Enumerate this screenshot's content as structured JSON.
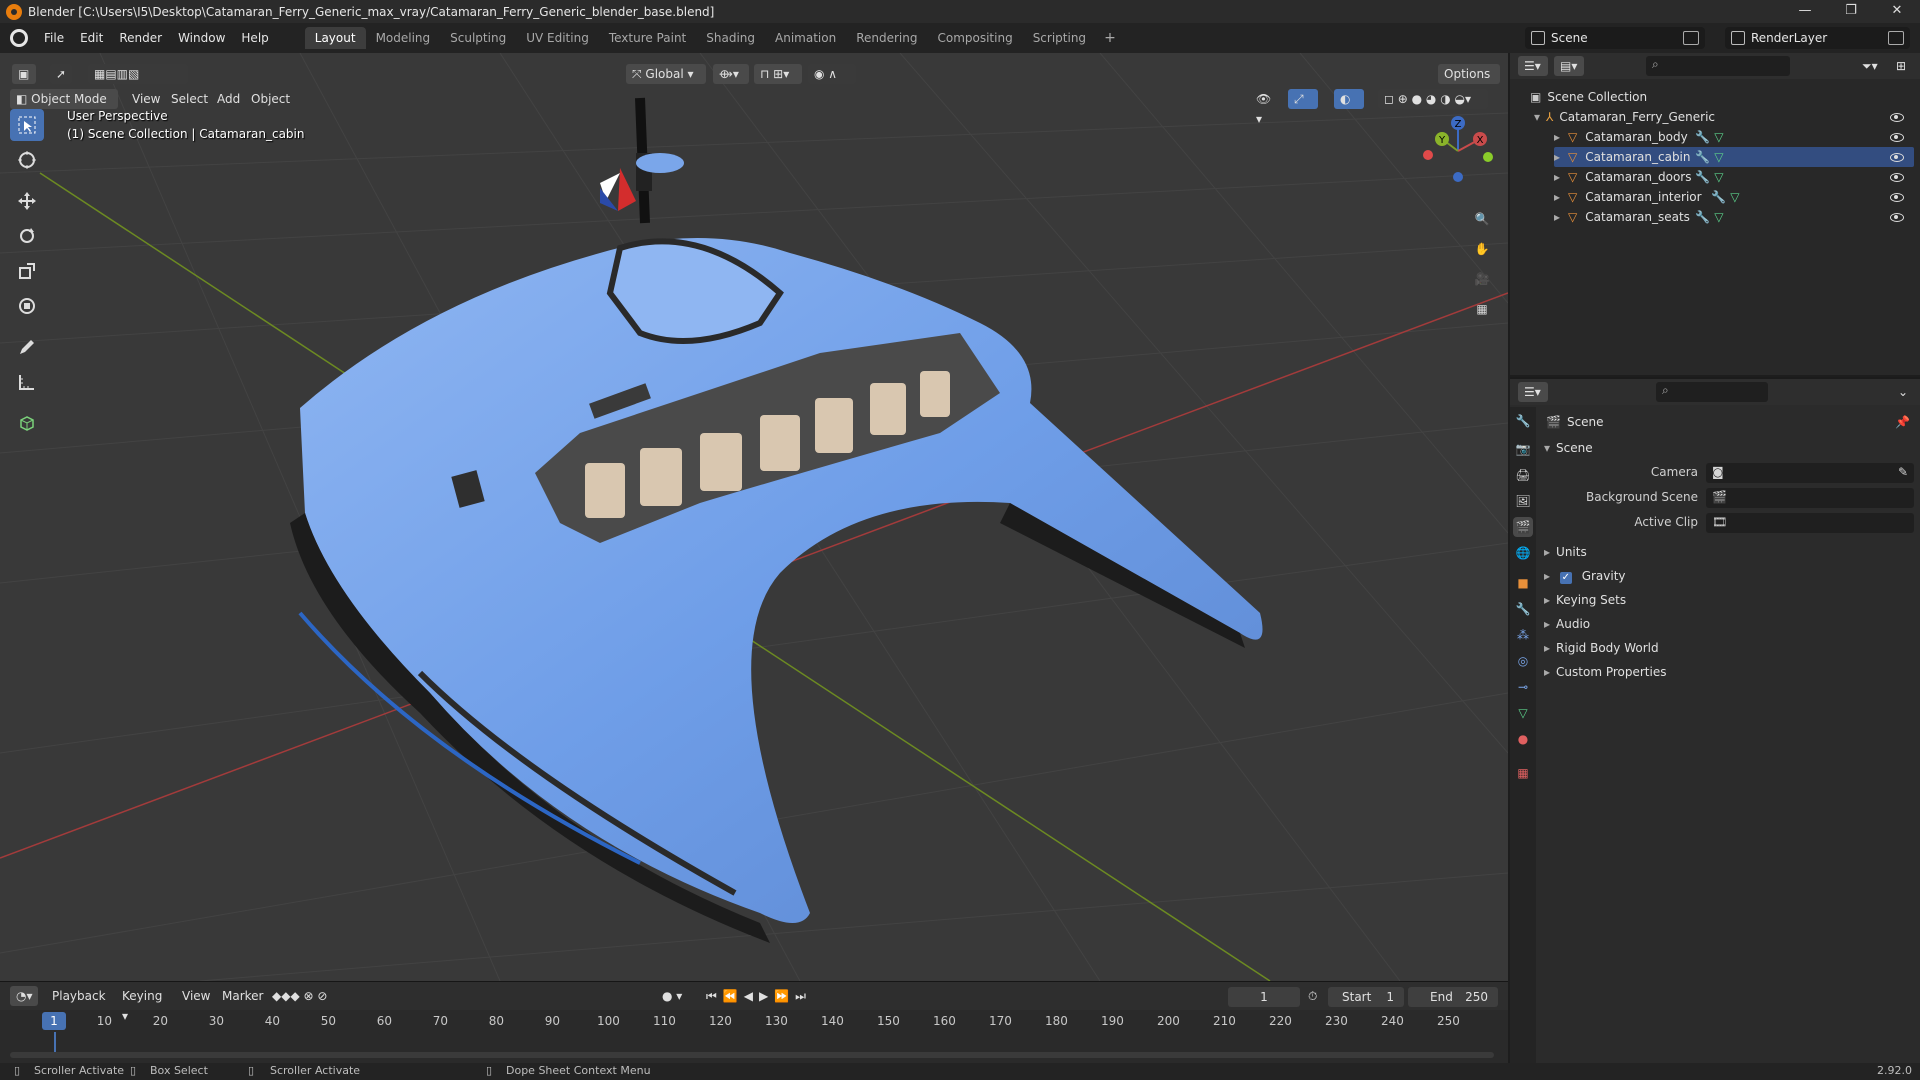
{
  "window": {
    "title": "Blender [C:\\Users\\I5\\Desktop\\Catamaran_Ferry_Generic_max_vray/Catamaran_Ferry_Generic_blender_base.blend]",
    "controls": [
      "—",
      "❐",
      "✕"
    ]
  },
  "menu": {
    "items": [
      "File",
      "Edit",
      "Render",
      "Window",
      "Help"
    ],
    "tabs": [
      "Layout",
      "Modeling",
      "Sculpting",
      "UV Editing",
      "Texture Paint",
      "Shading",
      "Animation",
      "Rendering",
      "Compositing",
      "Scripting"
    ],
    "add_tab": "+",
    "scene": "Scene",
    "render_layer": "RenderLayer"
  },
  "viewport": {
    "mode": "Object Mode",
    "menus": [
      "View",
      "Select",
      "Add",
      "Object"
    ],
    "transform_orientation": "Global",
    "options": "Options",
    "overlay_line1": "User Perspective",
    "overlay_line2": "(1) Scene Collection | Catamaran_cabin",
    "gizmo": {
      "x": "X",
      "y": "Y",
      "z": "Z"
    }
  },
  "outliner": {
    "root": "Scene Collection",
    "collection": "Catamaran_Ferry_Generic",
    "objects": [
      "Catamaran_body",
      "Catamaran_cabin",
      "Catamaran_doors",
      "Catamaran_interior",
      "Catamaran_seats"
    ],
    "active_index": 1
  },
  "properties": {
    "header": "Scene",
    "panel": "Scene",
    "fields": [
      {
        "label": "Camera"
      },
      {
        "label": "Background Scene"
      },
      {
        "label": "Active Clip"
      }
    ],
    "sections": [
      "Units",
      "Gravity",
      "Keying Sets",
      "Audio",
      "Rigid Body World",
      "Custom Properties"
    ],
    "gravity_checked": true
  },
  "timeline": {
    "menus": [
      "Playback",
      "Keying",
      "View",
      "Marker"
    ],
    "current_frame": "1",
    "start_label": "Start",
    "start": "1",
    "end_label": "End",
    "end": "250",
    "ruler": [
      "1",
      "10",
      "20",
      "30",
      "40",
      "50",
      "60",
      "70",
      "80",
      "90",
      "100",
      "110",
      "120",
      "130",
      "140",
      "150",
      "160",
      "170",
      "180",
      "190",
      "200",
      "210",
      "220",
      "230",
      "240",
      "250"
    ]
  },
  "status": {
    "items": [
      "Scroller Activate",
      "Box Select",
      "Scroller Activate",
      "Dope Sheet Context Menu"
    ],
    "version": "2.92.0"
  },
  "colors": {
    "accent": "#4772b3",
    "hull": "#6f9ee8",
    "axis_x": "#c94b4b",
    "axis_y": "#7a9a2a"
  }
}
